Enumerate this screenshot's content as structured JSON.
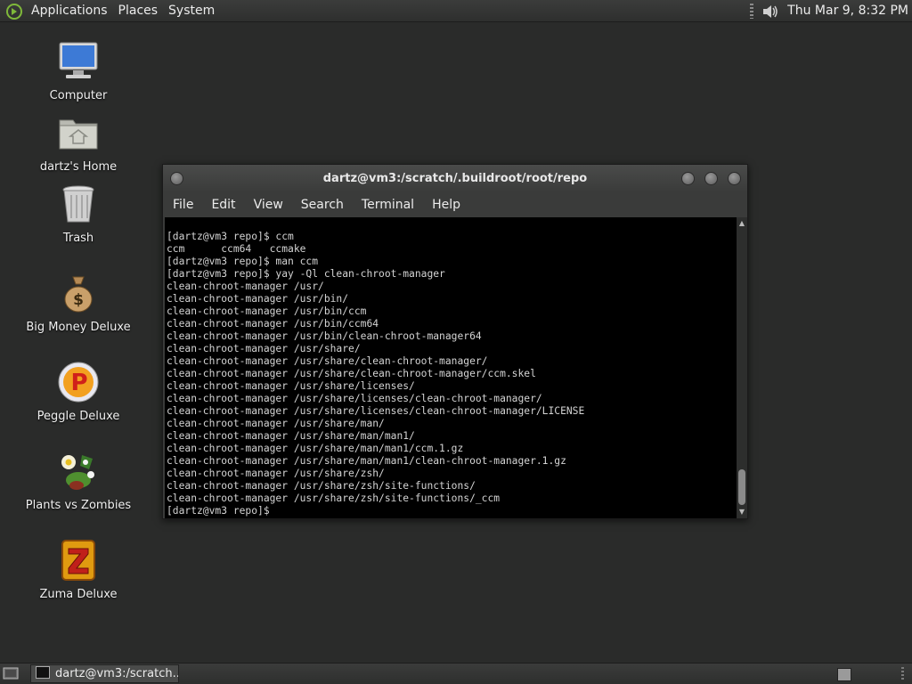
{
  "top_panel": {
    "menus": [
      "Applications",
      "Places",
      "System"
    ],
    "clock": "Thu Mar  9,  8:32 PM"
  },
  "desktop_icons": [
    {
      "label": "Computer",
      "icon": "computer-icon"
    },
    {
      "label": "dartz's Home",
      "icon": "home-folder-icon"
    },
    {
      "label": "Trash",
      "icon": "trash-icon"
    },
    {
      "label": "Big Money Deluxe",
      "icon": "money-bag-icon"
    },
    {
      "label": "Peggle Deluxe",
      "icon": "peggle-icon"
    },
    {
      "label": "Plants vs Zombies",
      "icon": "plants-icon"
    },
    {
      "label": "Zuma Deluxe",
      "icon": "zuma-icon"
    }
  ],
  "terminal": {
    "title": "dartz@vm3:/scratch/.buildroot/root/repo",
    "menu": [
      "File",
      "Edit",
      "View",
      "Search",
      "Terminal",
      "Help"
    ],
    "lines": [
      "[dartz@vm3 repo]$ ccm",
      "ccm      ccm64   ccmake",
      "[dartz@vm3 repo]$ man ccm",
      "[dartz@vm3 repo]$ yay -Ql clean-chroot-manager",
      "clean-chroot-manager /usr/",
      "clean-chroot-manager /usr/bin/",
      "clean-chroot-manager /usr/bin/ccm",
      "clean-chroot-manager /usr/bin/ccm64",
      "clean-chroot-manager /usr/bin/clean-chroot-manager64",
      "clean-chroot-manager /usr/share/",
      "clean-chroot-manager /usr/share/clean-chroot-manager/",
      "clean-chroot-manager /usr/share/clean-chroot-manager/ccm.skel",
      "clean-chroot-manager /usr/share/licenses/",
      "clean-chroot-manager /usr/share/licenses/clean-chroot-manager/",
      "clean-chroot-manager /usr/share/licenses/clean-chroot-manager/LICENSE",
      "clean-chroot-manager /usr/share/man/",
      "clean-chroot-manager /usr/share/man/man1/",
      "clean-chroot-manager /usr/share/man/man1/ccm.1.gz",
      "clean-chroot-manager /usr/share/man/man1/clean-chroot-manager.1.gz",
      "clean-chroot-manager /usr/share/zsh/",
      "clean-chroot-manager /usr/share/zsh/site-functions/",
      "clean-chroot-manager /usr/share/zsh/site-functions/_ccm",
      "[dartz@vm3 repo]$ "
    ]
  },
  "taskbar": {
    "task_label": "dartz@vm3:/scratch..."
  }
}
